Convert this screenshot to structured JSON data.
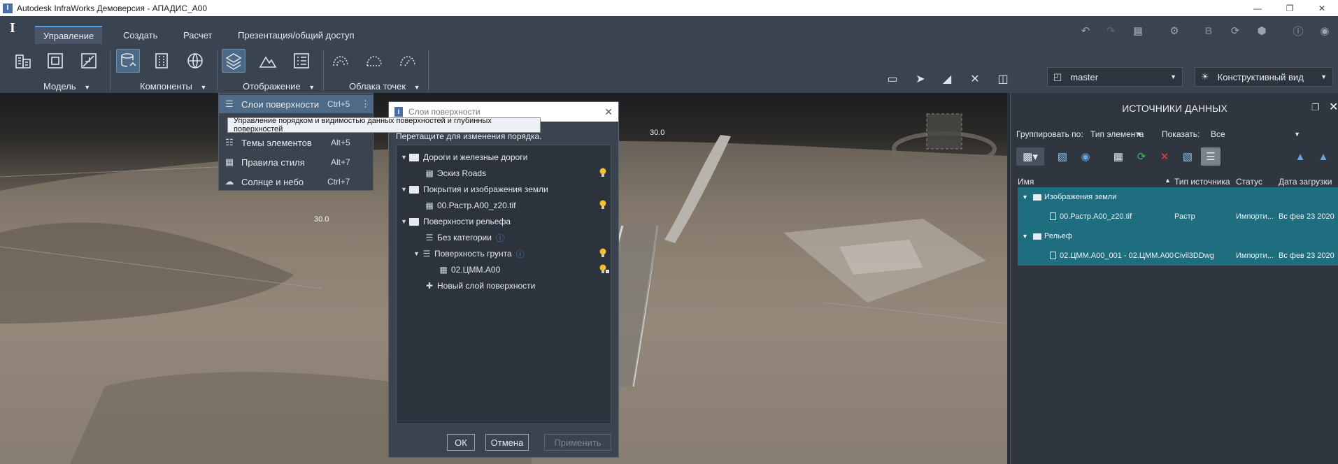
{
  "window": {
    "title": "Autodesk InfraWorks Демоверсия - АПАДИС_А00"
  },
  "tabs": [
    {
      "label": "Управление"
    },
    {
      "label": "Создать"
    },
    {
      "label": "Расчет"
    },
    {
      "label": "Презентация/общий доступ"
    }
  ],
  "ribbon": {
    "groups": [
      "Модель",
      "Компоненты",
      "Отображение",
      "Облака точек"
    ],
    "branch": "master",
    "view": "Конструктивный вид"
  },
  "menu": {
    "items": [
      {
        "label": "Слои поверхности",
        "shortcut": "Ctrl+5"
      },
      {
        "label": "Темы элементов",
        "shortcut": "Alt+5"
      },
      {
        "label": "Правила стиля",
        "shortcut": "Alt+7"
      },
      {
        "label": "Солнце и небо",
        "shortcut": "Ctrl+7"
      }
    ],
    "tooltip": "Управление порядком и видимостью данных поверхностей и глубинных поверхностей"
  },
  "viewport": {
    "labels": [
      "30.0",
      "30.0"
    ]
  },
  "dialog": {
    "title": "Слои поверхности",
    "hint": "Перетащите для изменения порядка.",
    "tree": [
      {
        "label": "Дороги и железные дороги"
      },
      {
        "label": "Эскиз Roads"
      },
      {
        "label": "Покрытия и изображения земли"
      },
      {
        "label": "00.Растр.А00_z20.tif"
      },
      {
        "label": "Поверхности рельефа"
      },
      {
        "label": "Без категории"
      },
      {
        "label": "Поверхность грунта"
      },
      {
        "label": "02.ЦММ.А00"
      },
      {
        "label": "Новый слой поверхности"
      }
    ],
    "buttons": {
      "ok": "ОК",
      "cancel": "Отмена",
      "apply": "Применить"
    }
  },
  "panel": {
    "title": "ИСТОЧНИКИ ДАННЫХ",
    "group_label": "Группировать по:",
    "group_value": "Тип элемента",
    "show_label": "Показать:",
    "show_value": "Все",
    "columns": [
      "Имя",
      "Тип источника",
      "Статус",
      "Дата загрузки"
    ],
    "groups": [
      {
        "name": "Изображения земли",
        "row": {
          "name": "00.Растр.А00_z20.tif",
          "type": "Растр",
          "status": "Импорти...",
          "date": "Вс фев 23 2020"
        }
      },
      {
        "name": "Рельеф",
        "row": {
          "name": "02.ЦММ.А00_001 - 02.ЦММ.А00",
          "type": "Civil3DDwg",
          "status": "Импорти...",
          "date": "Вс фев 23 2020"
        }
      }
    ]
  },
  "colors": {
    "accent": "#5aa0e6",
    "selection": "#1e6e80",
    "ribbon": "#3a4350"
  }
}
